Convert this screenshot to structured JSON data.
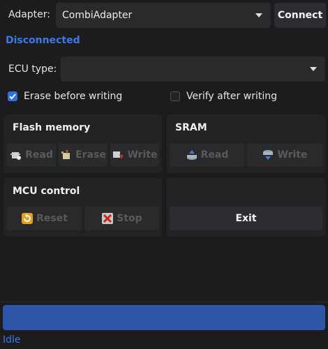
{
  "adapter": {
    "label": "Adapter:",
    "value": "CombiAdapter",
    "connect_label": "Connect"
  },
  "connection_status": "Disconnected",
  "ecu": {
    "label": "ECU type:",
    "value": ""
  },
  "options": {
    "erase_before_writing": {
      "label": "Erase before writing",
      "checked": true
    },
    "verify_after_writing": {
      "label": "Verify after writing",
      "checked": false
    }
  },
  "flash_memory": {
    "title": "Flash memory",
    "buttons": [
      {
        "label": "Read",
        "icon": "chip-read-icon"
      },
      {
        "label": "Erase",
        "icon": "chip-erase-icon"
      },
      {
        "label": "Write",
        "icon": "chip-write-icon"
      }
    ]
  },
  "sram": {
    "title": "SRAM",
    "buttons": [
      {
        "label": "Read",
        "icon": "sram-read-icon"
      },
      {
        "label": "Write",
        "icon": "sram-write-icon"
      }
    ]
  },
  "mcu_control": {
    "title": "MCU control",
    "buttons": [
      {
        "label": "Reset",
        "icon": "reset-icon"
      },
      {
        "label": "Stop",
        "icon": "stop-icon"
      }
    ]
  },
  "exit_label": "Exit",
  "progress": {
    "value": 1.0,
    "color": "#2f55a8"
  },
  "status_text": "Idle",
  "colors": {
    "accent": "#2f6fe0",
    "status": "#3b7ae8",
    "background": "#1c1c1e"
  }
}
